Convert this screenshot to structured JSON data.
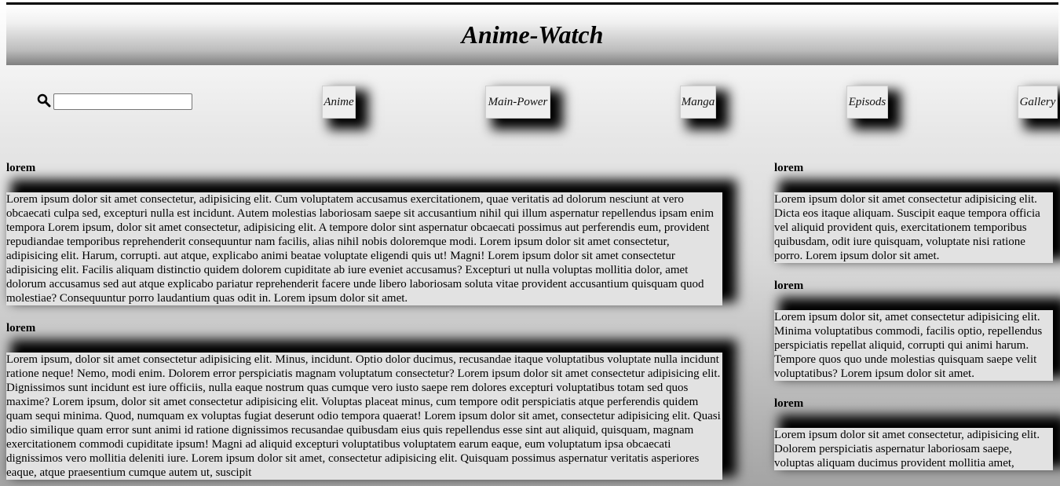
{
  "header": {
    "title": "Anime-Watch"
  },
  "search": {
    "icon": "search-icon",
    "value": "",
    "placeholder": ""
  },
  "nav": {
    "items": [
      {
        "label": "Anime"
      },
      {
        "label": "Main-Power"
      },
      {
        "label": "Manga"
      },
      {
        "label": "Episods"
      },
      {
        "label": "Gallery"
      }
    ]
  },
  "main": {
    "sections": [
      {
        "title": "lorem",
        "body": "Lorem ipsum dolor sit amet consectetur, adipisicing elit. Cum voluptatem accusamus exercitationem, quae veritatis ad dolorum nesciunt at vero obcaecati culpa sed, excepturi nulla est incidunt. Autem molestias laboriosam saepe sit accusantium nihil qui illum aspernatur repellendus ipsam enim tempora Lorem ipsum, dolor sit amet consectetur, adipisicing elit. A tempore dolor sint aspernatur obcaecati possimus aut perferendis eum, provident repudiandae temporibus reprehenderit consequuntur nam facilis, alias nihil nobis doloremque modi. Lorem ipsum dolor sit amet consectetur, adipisicing elit. Harum, corrupti. aut atque, explicabo animi beatae voluptate eligendi quis ut! Magni! Lorem ipsum dolor sit amet consectetur adipisicing elit. Facilis aliquam distinctio quidem dolorem cupiditate ab iure eveniet accusamus? Excepturi ut nulla voluptas mollitia dolor, amet dolorum accusamus sed aut atque explicabo pariatur reprehenderit facere unde libero laboriosam soluta vitae provident accusantium quisquam quod molestiae? Consequuntur porro laudantium quas odit in. Lorem ipsum dolor sit amet."
      },
      {
        "title": "lorem",
        "body": "Lorem ipsum, dolor sit amet consectetur adipisicing elit. Minus, incidunt. Optio dolor ducimus, recusandae itaque voluptatibus voluptate nulla incidunt ratione neque! Nemo, modi enim. Dolorem error perspiciatis magnam voluptatum consectetur? Lorem ipsum dolor sit amet consectetur adipisicing elit. Dignissimos sunt incidunt est iure officiis, nulla eaque nostrum quas cumque vero iusto saepe rem dolores excepturi voluptatibus totam sed quos maxime? Lorem ipsum, dolor sit amet consectetur adipisicing elit. Voluptas placeat minus, cum tempore odit perspiciatis atque perferendis quidem quam sequi minima. Quod, numquam ex voluptas fugiat deserunt odio tempora quaerat! Lorem ipsum dolor sit amet, consectetur adipisicing elit. Quasi odio similique quam error sunt animi id ratione dignissimos recusandae quibusdam eius quis repellendus esse sint aut aliquid, quisquam, magnam exercitationem commodi cupiditate ipsum! Magni ad aliquid excepturi voluptatibus voluptatem earum eaque, eum voluptatum ipsa obcaecati dignissimos vero mollitia deleniti iure. Lorem ipsum dolor sit amet, consectetur adipisicing elit. Quisquam possimus aspernatur veritatis asperiores eaque, atque praesentium cumque autem ut, suscipit"
      }
    ]
  },
  "side": {
    "sections": [
      {
        "title": "lorem",
        "body": "Lorem ipsum dolor sit amet consectetur adipisicing elit. Dicta eos itaque aliquam. Suscipit eaque tempora officia vel aliquid provident quis, exercitationem temporibus quibusdam, odit iure quisquam, voluptate nisi ratione porro. Lorem ipsum dolor sit amet."
      },
      {
        "title": "lorem",
        "body": "Lorem ipsum dolor sit, amet consectetur adipisicing elit. Minima voluptatibus commodi, facilis optio, repellendus perspiciatis repellat aliquid, corrupti qui animi harum. Tempore quos quo unde molestias quisquam saepe velit voluptatibus? Lorem ipsum dolor sit amet."
      },
      {
        "title": "lorem",
        "body": "Lorem ipsum dolor sit amet consectetur, adipisicing elit. Dolorem perspiciatis aspernatur laboriosam saepe, voluptas aliquam ducimus provident mollitia amet,"
      }
    ]
  }
}
